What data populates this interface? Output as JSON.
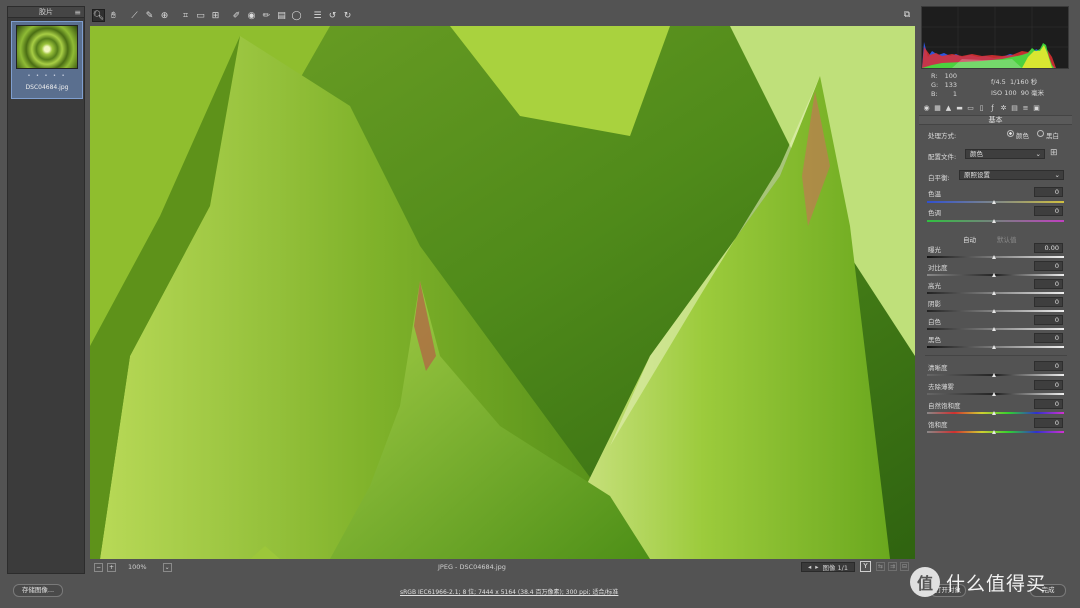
{
  "filmstrip": {
    "title": "胶片",
    "menu_icon": "menu-icon",
    "thumbnail": {
      "filename": "DSC04684.jpg",
      "stars": "• • • • •"
    }
  },
  "toolbar": {
    "tools": [
      "zoom-icon",
      "hand-icon",
      "white-balance-icon",
      "color-sampler-icon",
      "target-adjust-icon",
      "crop-icon",
      "straighten-icon",
      "transform-icon",
      "spot-removal-icon",
      "red-eye-icon",
      "adjustment-brush-icon",
      "graduated-filter-icon",
      "radial-filter-icon",
      "presets-list-icon",
      "rotate-ccw-icon",
      "rotate-cw-icon"
    ],
    "fullscreen_icon": "fullscreen-icon"
  },
  "statusbar": {
    "zoom_out": "−",
    "zoom_in": "+",
    "zoom_level": "100%",
    "file_info": "JPEG -  DSC04684.jpg",
    "image_counter": "图像 1/1",
    "prev": "◂",
    "next": "▸",
    "y_label": "Y"
  },
  "histogram": {
    "colors": {
      "red": "#e03030",
      "green": "#3ee23e",
      "blue": "#3060ff",
      "yellow": "#e8e830",
      "magenta": "#d040d0",
      "white": "#f0f0f0"
    }
  },
  "exif": {
    "r_label": "R:",
    "r_value": "100",
    "g_label": "G:",
    "g_value": "133",
    "b_label": "B:",
    "b_value": "1",
    "aperture": "f/4.5",
    "shutter": "1/160 秒",
    "iso": "ISO 100",
    "focal": "90 毫米"
  },
  "panel": {
    "title": "基本",
    "process_label": "处理方式:",
    "process_color": "颜色",
    "process_bw": "黑白",
    "profile_label": "配置文件:",
    "profile_value": "颜色",
    "wb_label": "白平衡:",
    "wb_value": "原照设置",
    "temp_label": "色温",
    "temp_value": "0",
    "tint_label": "色调",
    "tint_value": "0",
    "auto": "自动",
    "default": "默认值",
    "exposure_label": "曝光",
    "exposure_value": "0.00",
    "contrast_label": "对比度",
    "contrast_value": "0",
    "highlights_label": "高光",
    "highlights_value": "0",
    "shadows_label": "阴影",
    "shadows_value": "0",
    "whites_label": "白色",
    "whites_value": "0",
    "blacks_label": "黑色",
    "blacks_value": "0",
    "clarity_label": "清晰度",
    "clarity_value": "0",
    "dehaze_label": "去除薄雾",
    "dehaze_value": "0",
    "vibrance_label": "自然饱和度",
    "vibrance_value": "0",
    "saturation_label": "饱和度",
    "saturation_value": "0"
  },
  "bottom": {
    "save_label": "存储图像...",
    "workflow_text": "sRGB IEC61966-2.1; 8 位; 7444 x 5164 (38.4 百万像素); 300 ppi; 适合/标准",
    "open_label": "打开对象",
    "done_label": "完成",
    "watermark_logo": "值",
    "watermark_text": "什么值得买"
  }
}
